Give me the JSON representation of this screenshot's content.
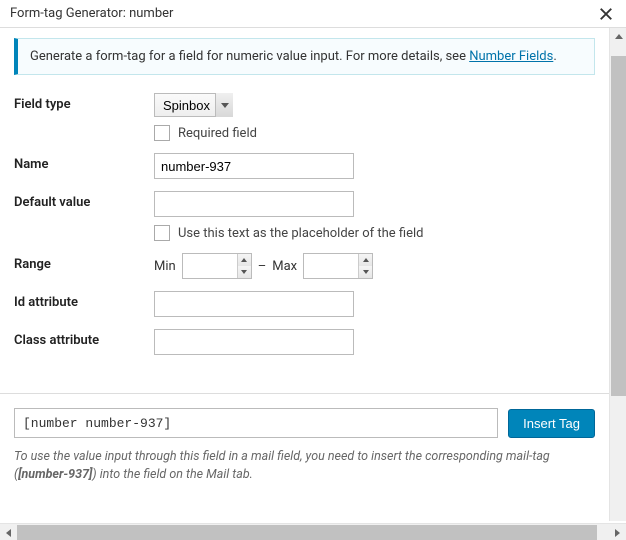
{
  "dialog": {
    "title": "Form-tag Generator: number"
  },
  "notice": {
    "text_before_link": "Generate a form-tag for a field for numeric value input. For more details, see ",
    "link": "Number Fields",
    "after": "."
  },
  "rows": {
    "field_type": {
      "label": "Field type",
      "selected": "Spinbox",
      "required_label": "Required field"
    },
    "name": {
      "label": "Name",
      "value": "number-937"
    },
    "default_value": {
      "label": "Default value",
      "value": "",
      "placeholder_label": "Use this text as the placeholder of the field"
    },
    "range": {
      "label": "Range",
      "min_label": "Min",
      "max_label": "Max",
      "dash": "–",
      "min_value": "",
      "max_value": ""
    },
    "id": {
      "label": "Id attribute",
      "value": ""
    },
    "class": {
      "label": "Class attribute",
      "value": ""
    }
  },
  "footer": {
    "tag_output": "[number number-937]",
    "insert_button": "Insert Tag",
    "hint_before": "To use the value input through this field in a mail field, you need to insert the corresponding mail-tag (",
    "hint_tag": "[number-937]",
    "hint_after": ") into the field on the Mail tab."
  }
}
